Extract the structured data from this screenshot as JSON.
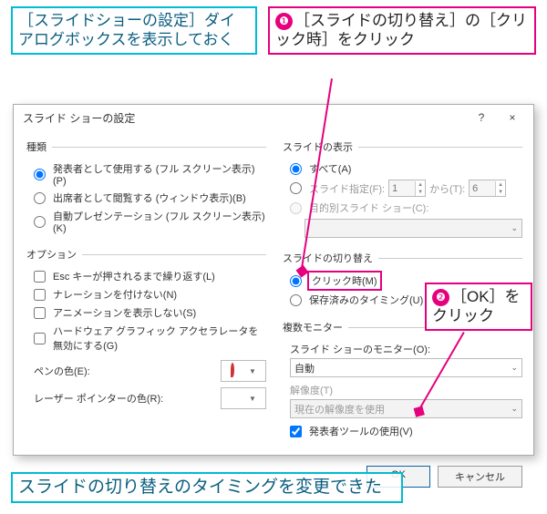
{
  "callouts": {
    "intro": "［スライドショーの設定］ダイアログボックスを表示しておく",
    "step1_num": "❶",
    "step1": "［スライドの切り替え］の［クリック時］をクリック",
    "step2_num": "❷",
    "step2": "［OK］をクリック",
    "result": "スライドの切り替えのタイミングを変更できた"
  },
  "dialog": {
    "title": "スライド ショーの設定",
    "help": "?",
    "close": "×",
    "type": {
      "legend": "種類",
      "r1": "発表者として使用する (フル スクリーン表示)(P)",
      "r2": "出席者として閲覧する (ウィンドウ表示)(B)",
      "r3": "自動プレゼンテーション (フル スクリーン表示)(K)"
    },
    "options": {
      "legend": "オプション",
      "c1": "Esc キーが押されるまで繰り返す(L)",
      "c2": "ナレーションを付けない(N)",
      "c3": "アニメーションを表示しない(S)",
      "c4": "ハードウェア グラフィック アクセラレータを無効にする(G)",
      "pen_label": "ペンの色(E):",
      "laser_label": "レーザー ポインターの色(R):"
    },
    "show": {
      "legend": "スライドの表示",
      "all": "すべて(A)",
      "range": "スライド指定(F):",
      "from_val": "1",
      "to_label": "から(T):",
      "to_val": "6",
      "custom": "目的別スライド ショー(C):"
    },
    "advance": {
      "legend": "スライドの切り替え",
      "click": "クリック時(M)",
      "timing": "保存済みのタイミング(U)"
    },
    "monitors": {
      "legend": "複数モニター",
      "mon_label": "スライド ショーのモニター(O):",
      "mon_val": "自動",
      "res_label": "解像度(T)",
      "res_val": "現在の解像度を使用",
      "presenter": "発表者ツールの使用(V)"
    },
    "buttons": {
      "ok": "OK",
      "cancel": "キャンセル"
    }
  }
}
